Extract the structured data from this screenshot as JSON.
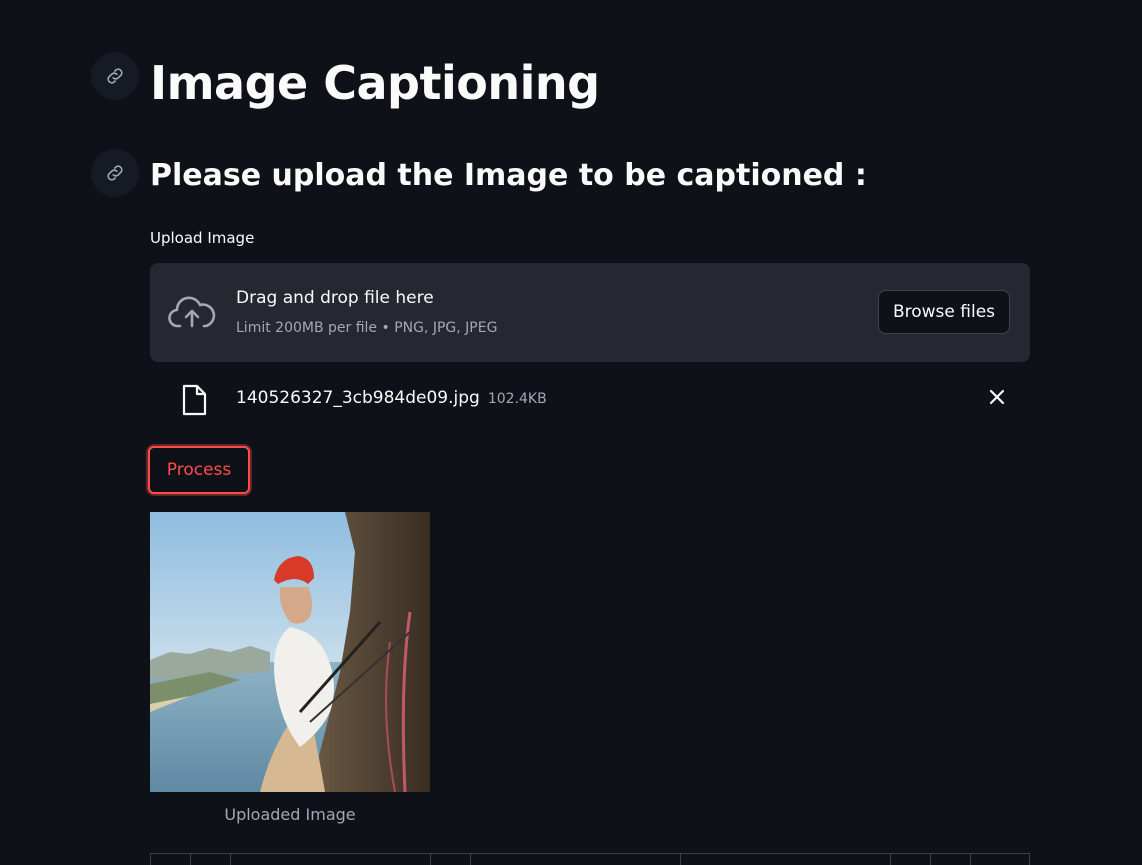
{
  "page": {
    "title": "Image Captioning",
    "subtitle": "Please upload the Image to be captioned :"
  },
  "uploader": {
    "label": "Upload Image",
    "drop_text": "Drag and drop file here",
    "limit_text": "Limit 200MB per file • PNG, JPG, JPEG",
    "browse_label": "Browse files",
    "file": {
      "name": "140526327_3cb984de09.jpg",
      "size": "102.4KB"
    }
  },
  "actions": {
    "process_label": "Process"
  },
  "image": {
    "caption": "Uploaded Image"
  },
  "icons": {
    "anchor": "link-icon",
    "upload": "cloud-upload-icon",
    "file": "file-icon",
    "remove": "close-icon"
  },
  "colors": {
    "background": "#0e1117",
    "panel": "#262730",
    "accent": "#ff4b4b",
    "muted_text": "#a3a8b8"
  }
}
